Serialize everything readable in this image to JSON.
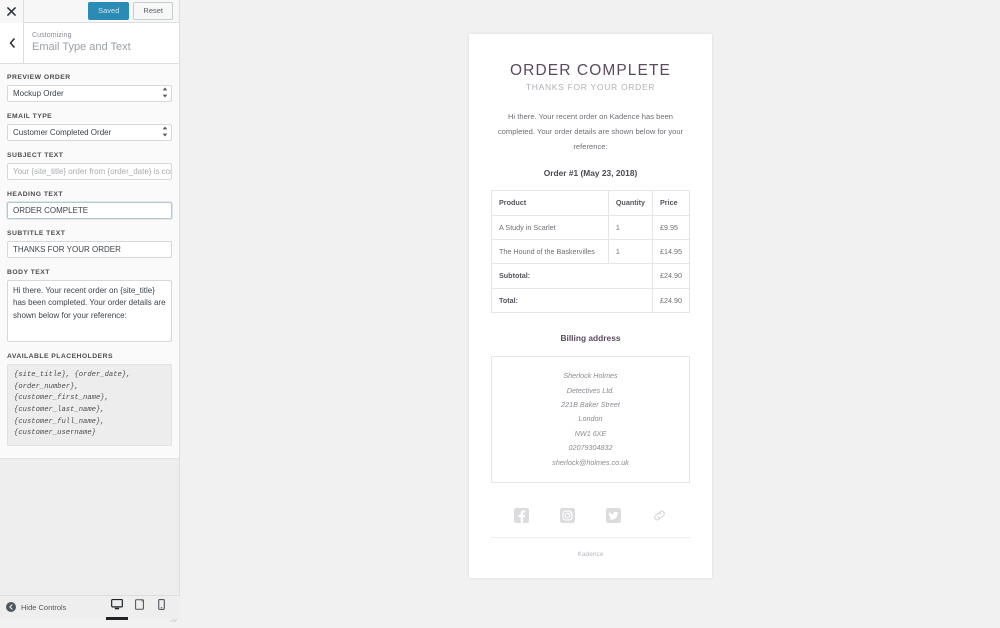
{
  "customizer": {
    "close_icon": "close-icon",
    "back_icon": "chevron-left-icon",
    "save_label": "Saved",
    "reset_label": "Reset",
    "eyebrow": "Customizing",
    "panel_title": "Email Type and Text",
    "controls": {
      "preview_order": {
        "label": "PREVIEW ORDER",
        "value": "Mockup Order"
      },
      "email_type": {
        "label": "EMAIL TYPE",
        "value": "Customer Completed Order"
      },
      "subject_text": {
        "label": "SUBJECT TEXT",
        "value": "",
        "placeholder": "Your {site_title} order from {order_date} is complete"
      },
      "heading_text": {
        "label": "HEADING TEXT",
        "value": "ORDER COMPLETE"
      },
      "subtitle_text": {
        "label": "SUBTITLE TEXT",
        "value": "THANKS FOR YOUR ORDER"
      },
      "body_text": {
        "label": "BODY TEXT",
        "value": "Hi there. Your recent order on {site_title} has been completed. Your order details are shown below for your reference:"
      },
      "placeholders": {
        "label": "AVAILABLE PLACEHOLDERS",
        "value": "{site_title}, {order_date}, {order_number}, {customer_first_name}, {customer_last_name}, {customer_full_name}, {customer_username}"
      }
    },
    "footer": {
      "hide_controls_label": "Hide Controls",
      "devices": [
        {
          "name": "desktop",
          "active": true
        },
        {
          "name": "tablet",
          "active": false
        },
        {
          "name": "mobile",
          "active": false
        }
      ]
    }
  },
  "email_preview": {
    "heading": "ORDER COMPLETE",
    "subtitle": "THANKS FOR YOUR ORDER",
    "body": "Hi there. Your recent order on Kadence has been completed. Your order details are shown below for your reference:",
    "order_title": "Order #1 (May 23, 2018)",
    "table": {
      "headers": [
        "Product",
        "Quantity",
        "Price"
      ],
      "rows": [
        [
          "A Study in Scarlet",
          "1",
          "£9.95"
        ],
        [
          "The Hound of the Baskervilles",
          "1",
          "£14.95"
        ]
      ],
      "totals": [
        {
          "label": "Subtotal:",
          "value": "£24.90"
        },
        {
          "label": "Total:",
          "value": "£24.90"
        }
      ]
    },
    "billing_title": "Billing address",
    "billing_address": [
      "Sherlock Holmes",
      "Detectives Ltd.",
      "221B Baker Street",
      "London",
      "NW1 6XE",
      "02079304832",
      "sherlock@holmes.co.uk"
    ],
    "social": [
      "facebook-icon",
      "instagram-icon",
      "twitter-icon",
      "link-icon"
    ],
    "footer_text": "Kadence"
  },
  "colors": {
    "accent_purple": "#5a4a5e",
    "save_button": "#2a8cb5",
    "sidebar_bg": "#eeeeee",
    "preview_bg": "#f1f1f1"
  }
}
